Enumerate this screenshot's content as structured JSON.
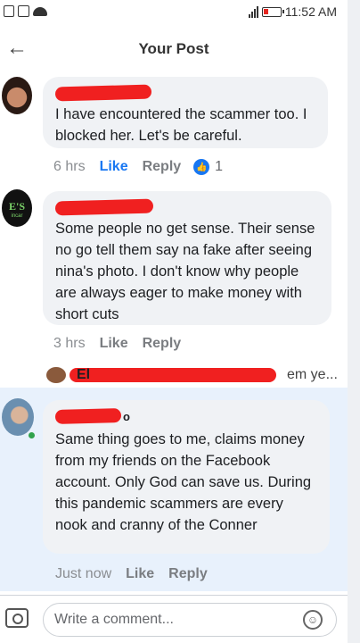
{
  "status_bar": {
    "time": "11:52 AM",
    "icons": [
      "sim-icon",
      "image-icon",
      "cloud-icon",
      "signal-icon",
      "battery-icon"
    ]
  },
  "header": {
    "title": "Your Post",
    "back_icon": "arrow-left-icon",
    "back_glyph": "←"
  },
  "comments": [
    {
      "text": "I have encountered the scammer too. I blocked her. Let's be careful.",
      "time": "6 hrs",
      "like_label": "Like",
      "reply_label": "Reply",
      "like_count": "1",
      "liked": true
    },
    {
      "text": "Some people no get sense. Their sense no go tell them say na fake after seeing nina's photo. I don't know why people are always eager to make money with short cuts",
      "time": "3 hrs",
      "like_label": "Like",
      "reply_label": "Reply",
      "avatar_text": "E'S",
      "avatar_subtext": "incar"
    },
    {
      "reply_preview_initials": "El",
      "reply_preview_snippet": "em ye...",
      "name_suffix": "o",
      "text": "Same thing goes to me, claims money from my friends on the Facebook account. Only God can save us. During this pandemic scammers are every nook and cranny of the Conner",
      "time": "Just now",
      "like_label": "Like",
      "reply_label": "Reply"
    }
  ],
  "composer": {
    "placeholder": "Write a comment...",
    "camera_icon": "camera-icon",
    "emoji_icon": "emoji-icon",
    "emoji_glyph": "☺"
  },
  "colors": {
    "accent": "#1877f2",
    "redaction": "#f02020",
    "bubble": "#f0f2f5",
    "highlight": "#e8f1fc",
    "online": "#31a24c"
  }
}
